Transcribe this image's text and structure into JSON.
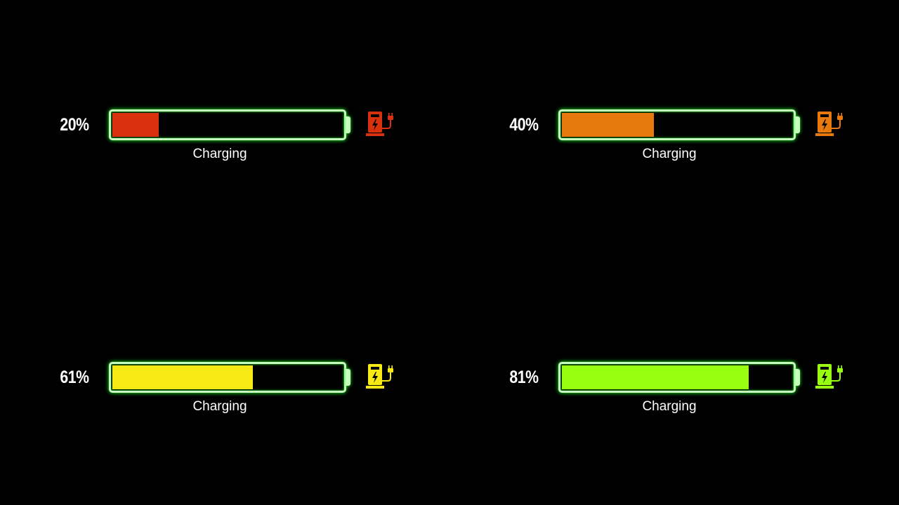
{
  "colors": {
    "outline": "#c8ffc0",
    "glow": "#22ff22",
    "background": "#000000"
  },
  "batteries": [
    {
      "percent_label": "20%",
      "level": 20,
      "status": "Charging",
      "color": "#d9300e",
      "icon": "charging-station-icon"
    },
    {
      "percent_label": "40%",
      "level": 40,
      "status": "Charging",
      "color": "#e8790c",
      "icon": "charging-station-icon"
    },
    {
      "percent_label": "61%",
      "level": 61,
      "status": "Charging",
      "color": "#f7e914",
      "icon": "charging-station-icon"
    },
    {
      "percent_label": "81%",
      "level": 81,
      "status": "Charging",
      "color": "#99ff11",
      "icon": "charging-station-icon"
    }
  ]
}
